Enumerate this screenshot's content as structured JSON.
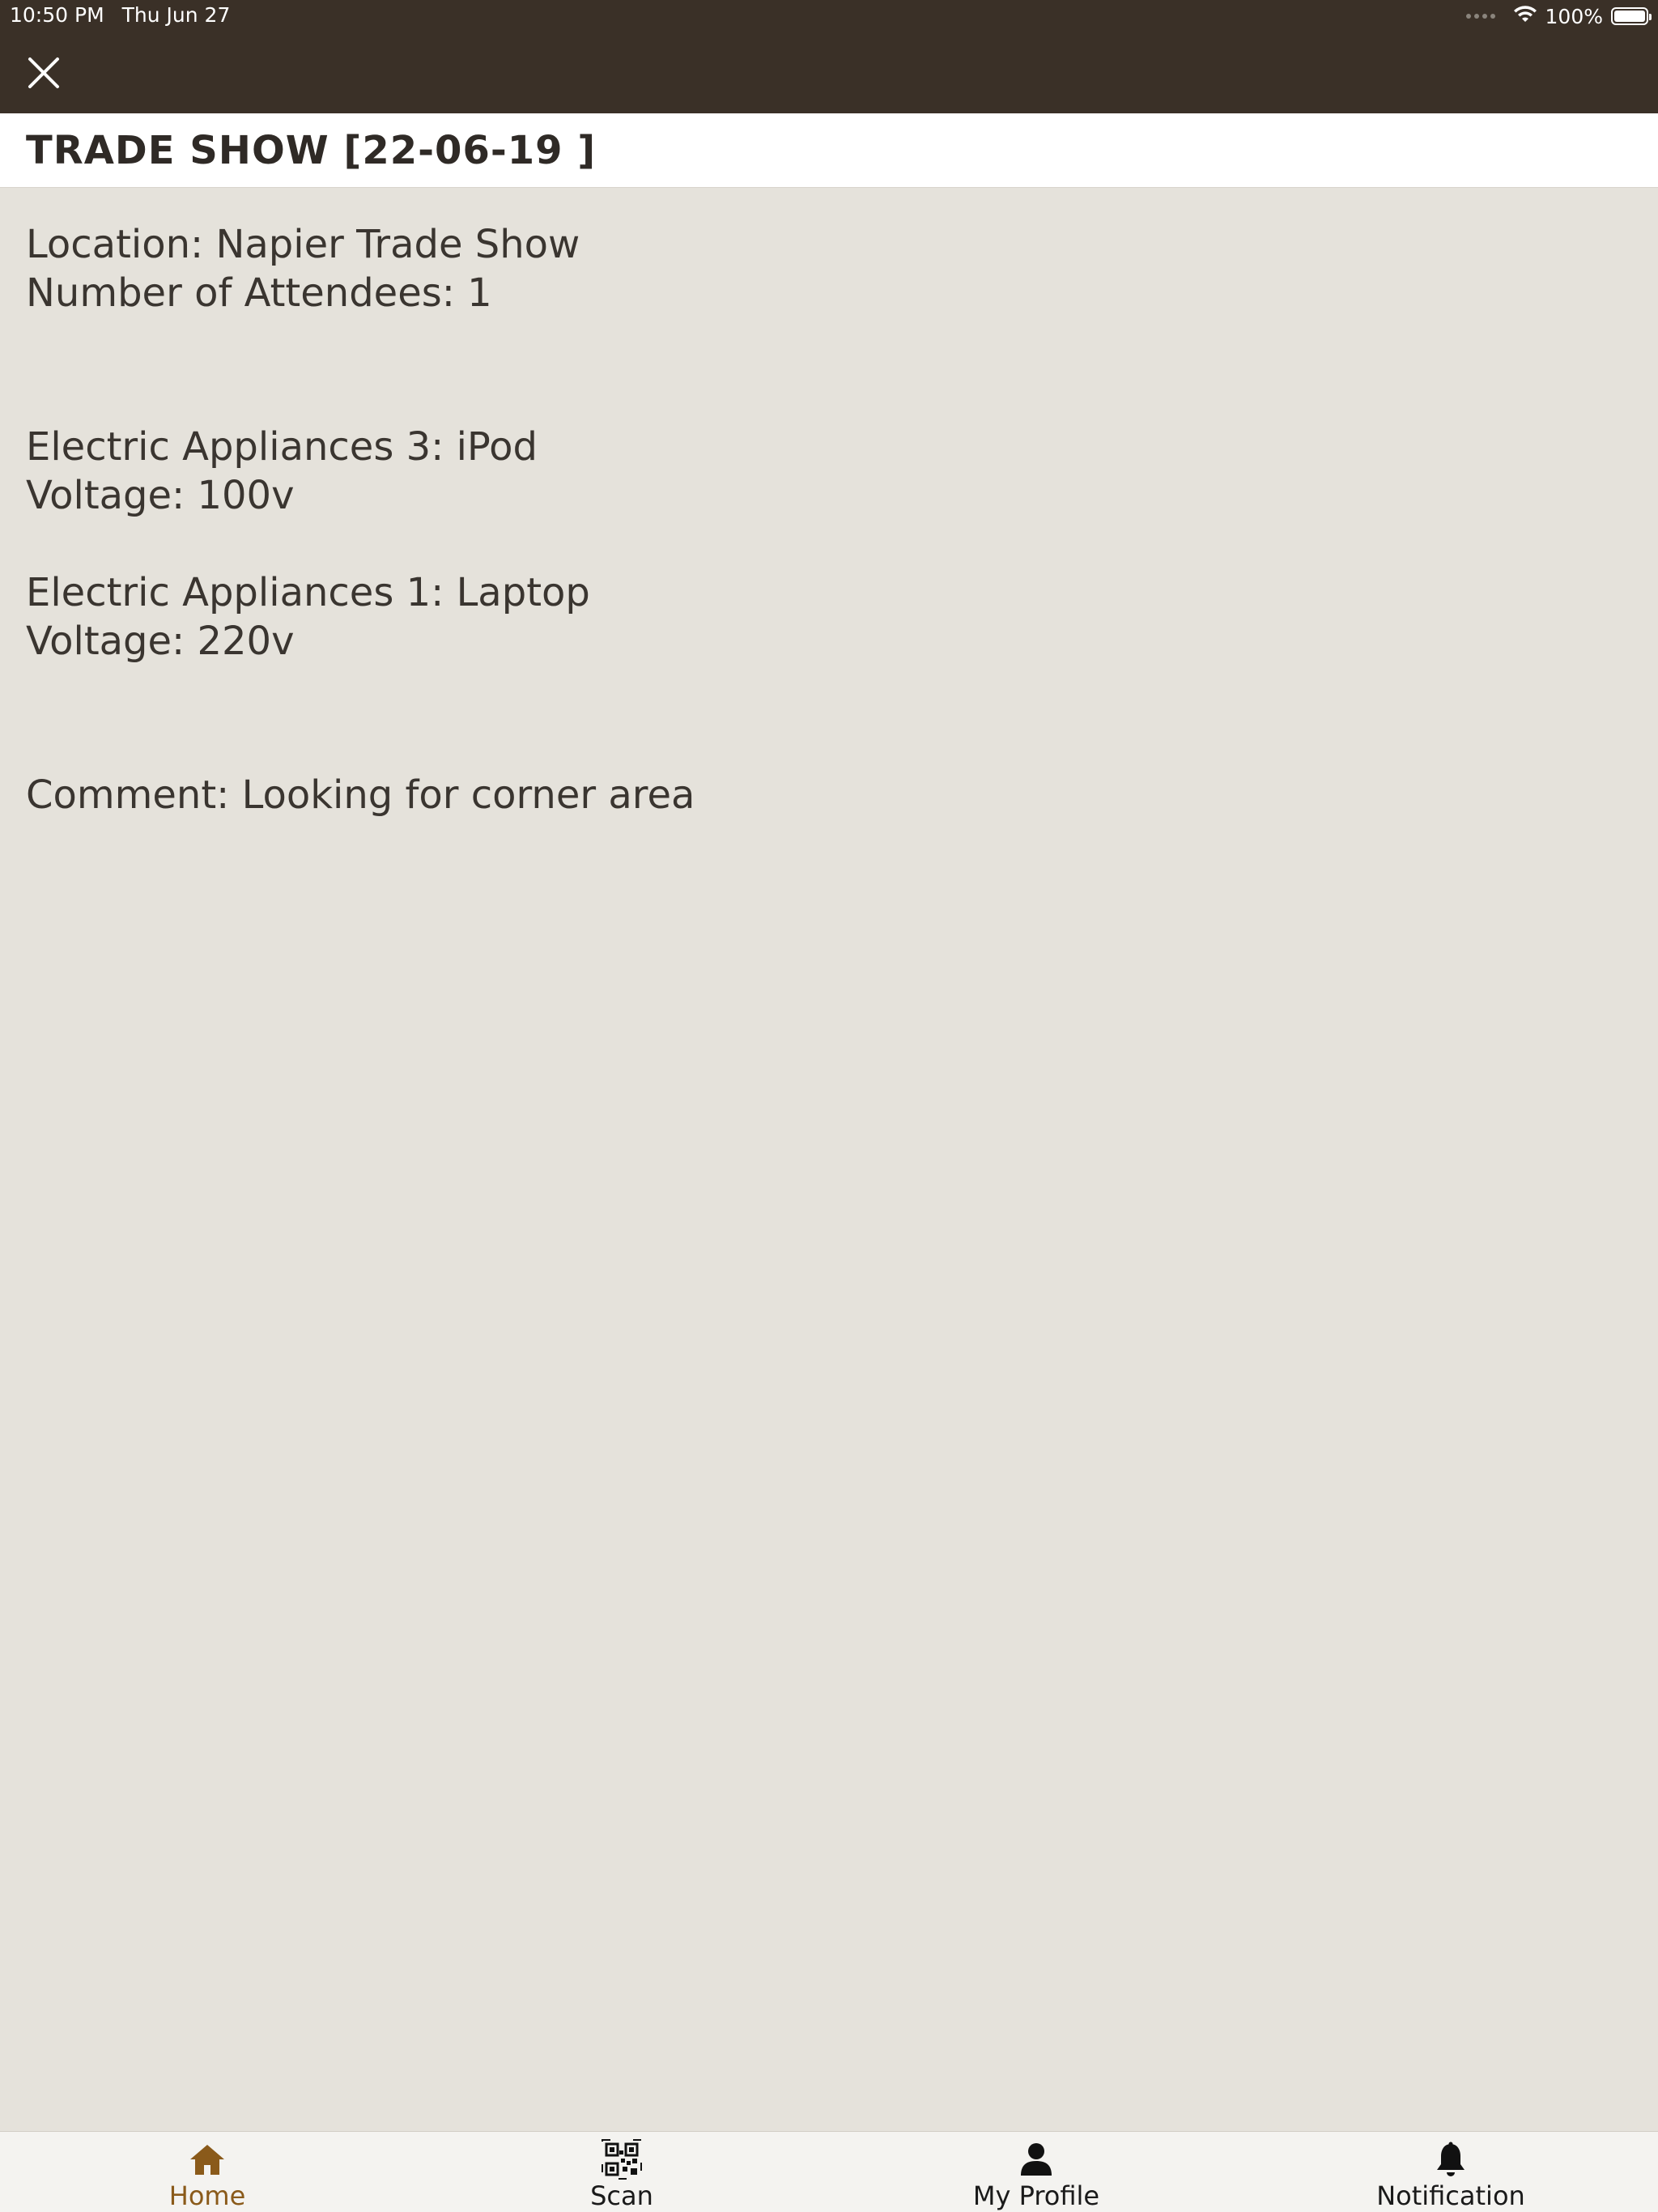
{
  "status_bar": {
    "time": "10:50 PM",
    "date": "Thu Jun 27",
    "battery": "100%"
  },
  "header": {
    "close_icon": "close-icon"
  },
  "page": {
    "title": "TRADE SHOW [22-06-19 ]"
  },
  "details": {
    "location": "Location: Napier Trade Show",
    "attendees": "Number of Attendees: 1",
    "appliances": [
      {
        "name": "Electric Appliances 3: iPod",
        "voltage": "Voltage: 100v"
      },
      {
        "name": "Electric Appliances 1: Laptop",
        "voltage": "Voltage: 220v"
      }
    ],
    "comment": "Comment: Looking for corner area"
  },
  "tabbar": {
    "tabs": [
      {
        "label": "Home",
        "icon": "home-icon",
        "active": true
      },
      {
        "label": "Scan",
        "icon": "qr-code-icon",
        "active": false
      },
      {
        "label": "My Profile",
        "icon": "person-icon",
        "active": false
      },
      {
        "label": "Notification",
        "icon": "bell-icon",
        "active": false
      }
    ]
  },
  "colors": {
    "header_bg": "#3a3027",
    "content_bg": "#e5e2db",
    "active_tab": "#8a5a1a"
  }
}
